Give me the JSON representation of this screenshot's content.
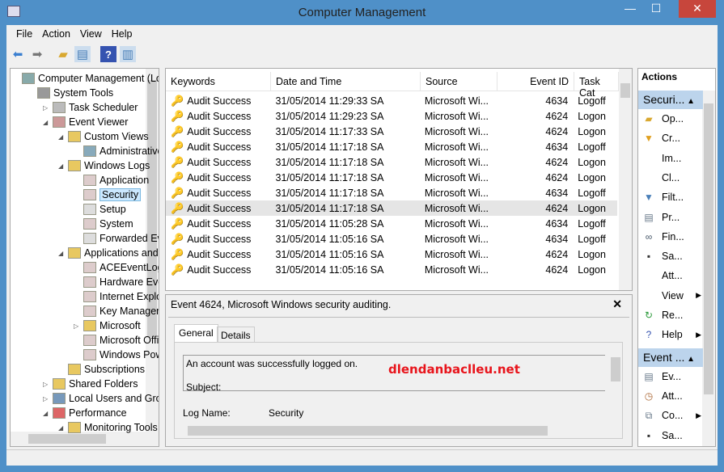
{
  "window": {
    "title": "Computer Management",
    "minimize": "—",
    "maximize": "☐",
    "close": "✕"
  },
  "menu": [
    "File",
    "Action",
    "View",
    "Help"
  ],
  "toolbar": [
    "back-icon",
    "forward-icon",
    "up-folder-icon",
    "show-hide-tree-icon",
    "help-icon",
    "action-pane-icon"
  ],
  "tree": [
    {
      "label": "Computer Management (Local",
      "depth": 0,
      "exp": ""
    },
    {
      "label": "System Tools",
      "depth": 1,
      "exp": ""
    },
    {
      "label": "Task Scheduler",
      "depth": 2,
      "exp": "▷"
    },
    {
      "label": "Event Viewer",
      "depth": 2,
      "exp": "◢"
    },
    {
      "label": "Custom Views",
      "depth": 3,
      "exp": "◢"
    },
    {
      "label": "Administrative Events",
      "depth": 4,
      "exp": ""
    },
    {
      "label": "Windows Logs",
      "depth": 3,
      "exp": "◢"
    },
    {
      "label": "Application",
      "depth": 4,
      "exp": ""
    },
    {
      "label": "Security",
      "depth": 4,
      "exp": "",
      "selected": true
    },
    {
      "label": "Setup",
      "depth": 4,
      "exp": ""
    },
    {
      "label": "System",
      "depth": 4,
      "exp": ""
    },
    {
      "label": "Forwarded Events",
      "depth": 4,
      "exp": ""
    },
    {
      "label": "Applications and Services Logs",
      "depth": 3,
      "exp": "◢"
    },
    {
      "label": "ACEEventLog",
      "depth": 4,
      "exp": ""
    },
    {
      "label": "Hardware Events",
      "depth": 4,
      "exp": ""
    },
    {
      "label": "Internet Explorer",
      "depth": 4,
      "exp": ""
    },
    {
      "label": "Key Management Service",
      "depth": 4,
      "exp": ""
    },
    {
      "label": "Microsoft",
      "depth": 4,
      "exp": "▷"
    },
    {
      "label": "Microsoft Office Alerts",
      "depth": 4,
      "exp": ""
    },
    {
      "label": "Windows PowerShell",
      "depth": 4,
      "exp": ""
    },
    {
      "label": "Subscriptions",
      "depth": 3,
      "exp": ""
    },
    {
      "label": "Shared Folders",
      "depth": 2,
      "exp": "▷"
    },
    {
      "label": "Local Users and Groups",
      "depth": 2,
      "exp": "▷"
    },
    {
      "label": "Performance",
      "depth": 2,
      "exp": "◢"
    },
    {
      "label": "Monitoring Tools",
      "depth": 3,
      "exp": "◢"
    }
  ],
  "events": {
    "columns": [
      "Keywords",
      "Date and Time",
      "Source",
      "Event ID",
      "Task Cat"
    ],
    "rows": [
      [
        "Audit Success",
        "31/05/2014 11:29:33 SA",
        "Microsoft Wi...",
        "4634",
        "Logoff"
      ],
      [
        "Audit Success",
        "31/05/2014 11:29:23 SA",
        "Microsoft Wi...",
        "4624",
        "Logon"
      ],
      [
        "Audit Success",
        "31/05/2014 11:17:33 SA",
        "Microsoft Wi...",
        "4624",
        "Logon"
      ],
      [
        "Audit Success",
        "31/05/2014 11:17:18 SA",
        "Microsoft Wi...",
        "4634",
        "Logoff"
      ],
      [
        "Audit Success",
        "31/05/2014 11:17:18 SA",
        "Microsoft Wi...",
        "4624",
        "Logon"
      ],
      [
        "Audit Success",
        "31/05/2014 11:17:18 SA",
        "Microsoft Wi...",
        "4624",
        "Logon"
      ],
      [
        "Audit Success",
        "31/05/2014 11:17:18 SA",
        "Microsoft Wi...",
        "4634",
        "Logoff"
      ],
      [
        "Audit Success",
        "31/05/2014 11:17:18 SA",
        "Microsoft Wi...",
        "4624",
        "Logon"
      ],
      [
        "Audit Success",
        "31/05/2014 11:05:28 SA",
        "Microsoft Wi...",
        "4634",
        "Logoff"
      ],
      [
        "Audit Success",
        "31/05/2014 11:05:16 SA",
        "Microsoft Wi...",
        "4634",
        "Logoff"
      ],
      [
        "Audit Success",
        "31/05/2014 11:05:16 SA",
        "Microsoft Wi...",
        "4624",
        "Logon"
      ],
      [
        "Audit Success",
        "31/05/2014 11:05:16 SA",
        "Microsoft Wi...",
        "4624",
        "Logon"
      ]
    ],
    "highlighted_row": 7
  },
  "detail": {
    "title": "Event 4624, Microsoft Windows security auditing.",
    "tabs": [
      "General",
      "Details"
    ],
    "active_tab": "General",
    "message_line1": "An account was successfully logged on.",
    "message_line2": "Subject:",
    "log_name_label": "Log Name:",
    "log_name_value": "Security",
    "watermark": "dlendanbaclleu.net"
  },
  "actions": {
    "header": "Actions",
    "groups": [
      {
        "title": "Securi...",
        "items": [
          {
            "label": "Op...",
            "icon": "open-folder-icon"
          },
          {
            "label": "Cr...",
            "icon": "create-filter-icon"
          },
          {
            "label": "Im...",
            "icon": ""
          },
          {
            "label": "Cl...",
            "icon": ""
          },
          {
            "label": "Filt...",
            "icon": "filter-icon"
          },
          {
            "label": "Pr...",
            "icon": "properties-icon"
          },
          {
            "label": "Fin...",
            "icon": "binoculars-icon"
          },
          {
            "label": "Sa...",
            "icon": "save-icon"
          },
          {
            "label": "Att...",
            "icon": ""
          },
          {
            "label": "View",
            "icon": "",
            "submenu": true
          },
          {
            "label": "Re...",
            "icon": "refresh-icon"
          },
          {
            "label": "Help",
            "icon": "help-icon",
            "submenu": true
          }
        ]
      },
      {
        "title": "Event ...",
        "items": [
          {
            "label": "Ev...",
            "icon": "event-properties-icon"
          },
          {
            "label": "Att...",
            "icon": "attach-task-icon"
          },
          {
            "label": "Co...",
            "icon": "copy-icon",
            "submenu": true
          },
          {
            "label": "Sa...",
            "icon": "save-icon"
          }
        ]
      }
    ]
  },
  "colors": {
    "frame": "#4f90c8",
    "close": "#c7463c",
    "selection": "#cce8ff",
    "group_header": "#bcd4ec",
    "watermark": "#e8141b"
  }
}
